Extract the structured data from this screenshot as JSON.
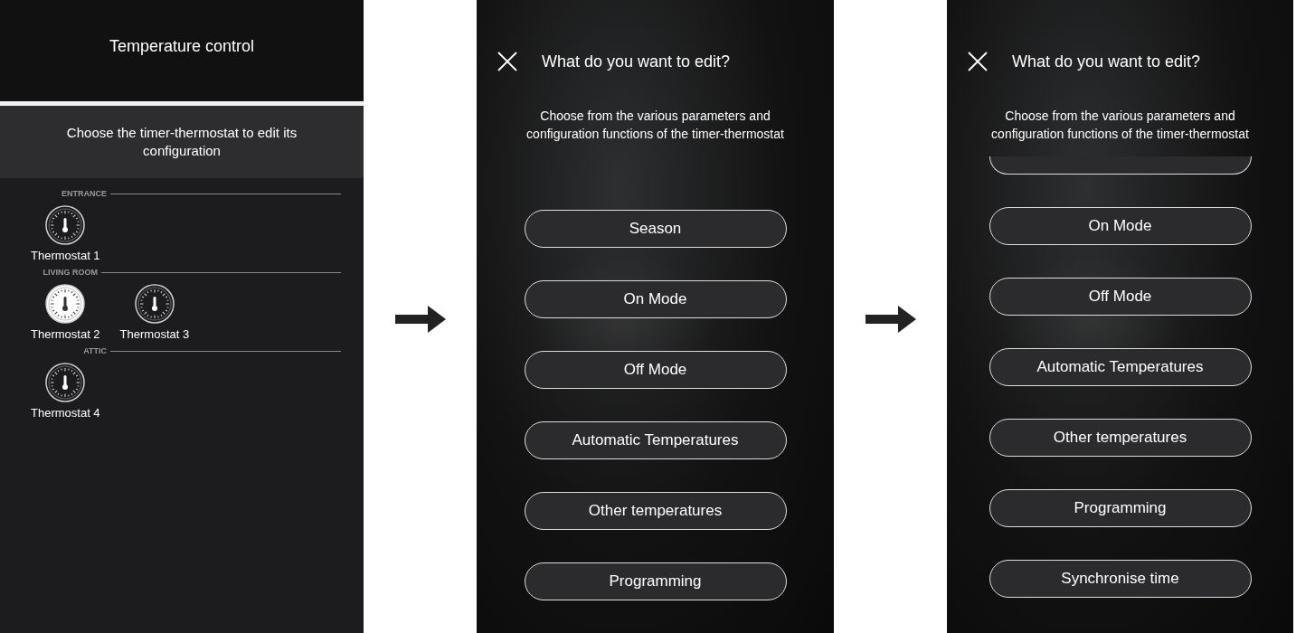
{
  "screens": [
    {
      "kind": "device-list",
      "title": "Temperature control",
      "subtitle": "Choose the timer-thermostat to edit its configuration",
      "groups": [
        {
          "name": "ENTRANCE",
          "thermostats": [
            {
              "label": "Thermostat 1",
              "selected": false
            }
          ]
        },
        {
          "name": "LIVING ROOM",
          "thermostats": [
            {
              "label": "Thermostat 2",
              "selected": true
            },
            {
              "label": "Thermostat 3",
              "selected": false
            }
          ]
        },
        {
          "name": "ATTIC",
          "thermostats": [
            {
              "label": "Thermostat 4",
              "selected": false
            }
          ]
        }
      ]
    },
    {
      "kind": "edit-menu",
      "title": "What do you want to edit?",
      "subtitle_lines": [
        "Choose from the various parameters and",
        "configuration functions of the timer-thermostat"
      ],
      "scrolled": false,
      "options": [
        "Season",
        "On Mode",
        "Off Mode",
        "Automatic Temperatures",
        "Other temperatures",
        "Programming"
      ]
    },
    {
      "kind": "edit-menu",
      "title": "What do you want to edit?",
      "subtitle_lines": [
        "Choose from the various parameters and",
        "configuration functions of the timer-thermostat"
      ],
      "scrolled": true,
      "options": [
        "On Mode",
        "Off Mode",
        "Automatic Temperatures",
        "Other temperatures",
        "Programming",
        "Synchronise time"
      ]
    }
  ]
}
